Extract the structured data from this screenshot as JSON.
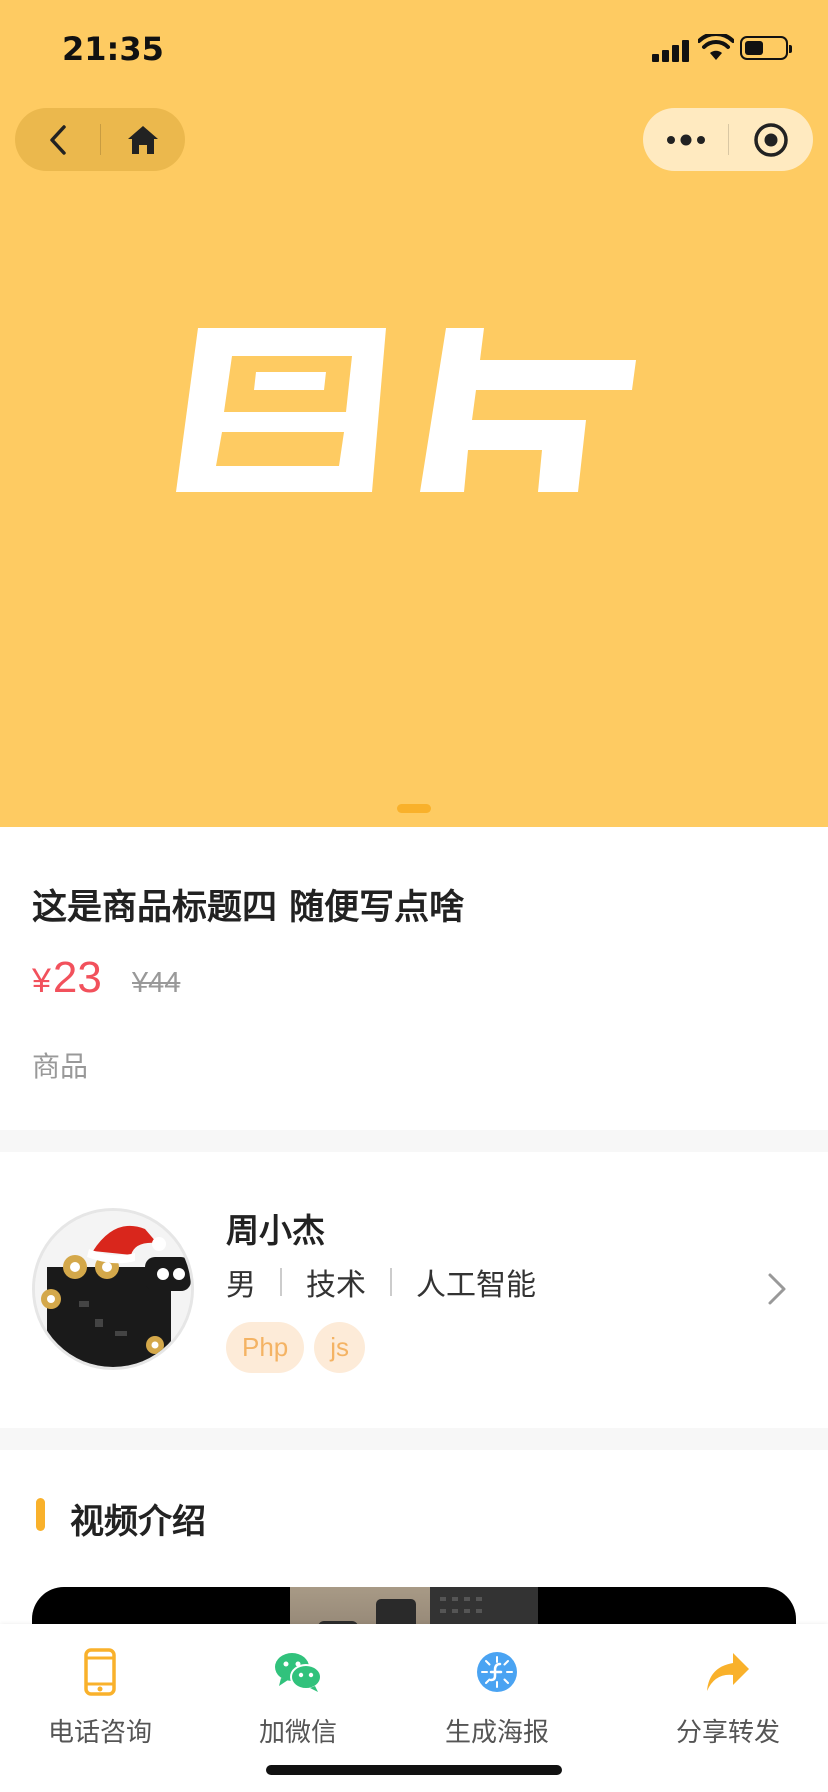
{
  "status_bar": {
    "time": "21:35"
  },
  "product": {
    "title": "这是商品标题四 随便写点啥",
    "price_symbol": "¥",
    "price": "23",
    "original_price": "¥44",
    "category": "商品"
  },
  "seller": {
    "name": "周小杰",
    "gender": "男",
    "role": "技术",
    "field": "人工智能",
    "tags": [
      "Php",
      "js"
    ]
  },
  "video_section": {
    "title": "视频介绍"
  },
  "bottom_bar": {
    "actions": [
      {
        "label": "电话咨询",
        "icon": "phone-icon"
      },
      {
        "label": "加微信",
        "icon": "wechat-icon"
      },
      {
        "label": "生成海报",
        "icon": "poster-icon"
      },
      {
        "label": "分享转发",
        "icon": "share-icon"
      }
    ]
  },
  "colors": {
    "hero_background": "#FECB62",
    "accent": "#F9B12B",
    "price": "#F2515C",
    "tag_bg": "#FDEBD8",
    "tag_text": "#F4B364"
  }
}
